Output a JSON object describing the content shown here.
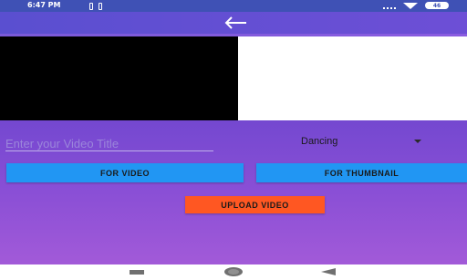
{
  "status_bar": {
    "time": "6:47 PM",
    "battery": "46"
  },
  "toolbar": {
    "back_icon": "arrow-left-icon"
  },
  "form": {
    "title_placeholder": "Enter your Video Title",
    "title_value": "",
    "category_selected": "Dancing"
  },
  "buttons": {
    "for_video": "FOR VIDEO",
    "for_thumbnail": "FOR THUMBNAIL",
    "upload_video": "UPLOAD VIDEO"
  },
  "colors": {
    "status_bar": "#3f51b5",
    "primary_button": "#2196f3",
    "upload_button": "#ff5722",
    "gradient_top": "#7448d0",
    "gradient_bottom": "#a25ad8"
  }
}
